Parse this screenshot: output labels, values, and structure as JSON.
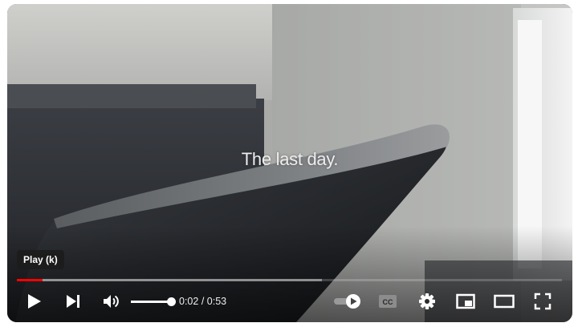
{
  "video": {
    "caption": "The last day."
  },
  "tooltip": {
    "text": "Play (k)"
  },
  "progress": {
    "played_fraction": 0.047,
    "loaded_fraction": 0.56
  },
  "controls": {
    "current_time": "0:02",
    "separator": " / ",
    "duration": "0:53",
    "volume_fraction": 1.0,
    "icons": {
      "play": "play-icon",
      "next": "next-icon",
      "volume": "volume-icon",
      "autoplay": "autoplay-toggle-icon",
      "subtitles": "cc-icon",
      "settings": "gear-icon",
      "miniplayer": "miniplayer-icon",
      "theater": "theater-mode-icon",
      "fullscreen": "fullscreen-icon"
    }
  },
  "colors": {
    "progress_played": "#ff0000",
    "tooltip_bg": "#1c1c1c"
  }
}
